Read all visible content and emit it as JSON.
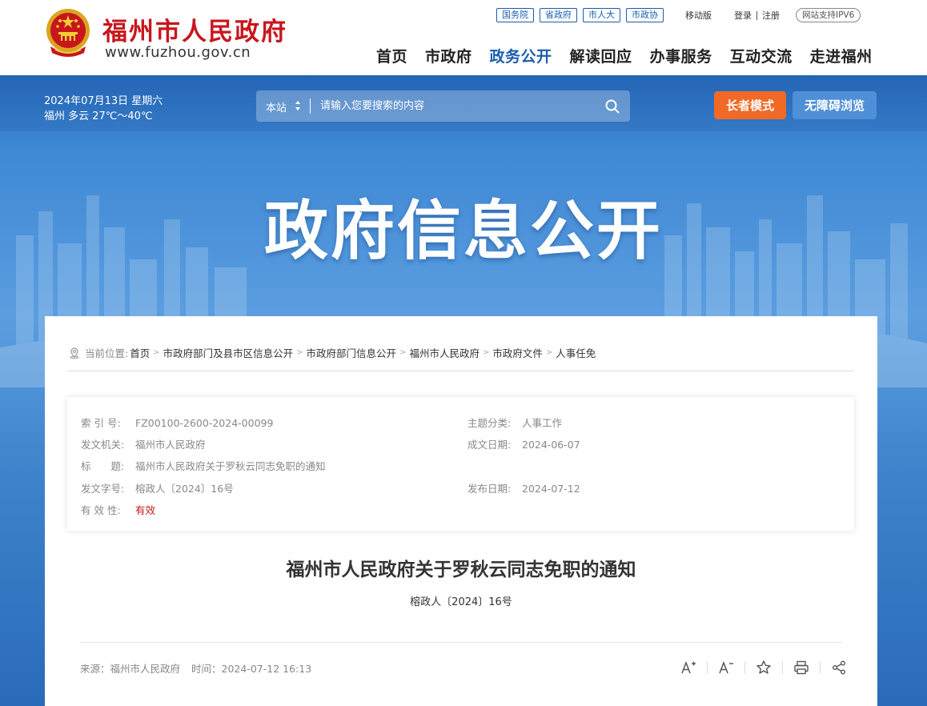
{
  "header": {
    "site_name": "福州市人民政府",
    "site_url": "www.fuzhou.gov.cn",
    "top_links": [
      "国务院",
      "省政府",
      "市人大",
      "市政协"
    ],
    "mobile": "移动版",
    "login": "登录",
    "register": "注册",
    "ipv6": "网站支持IPV6",
    "nav": [
      "首页",
      "市政府",
      "政务公开",
      "解读回应",
      "办事服务",
      "互动交流",
      "走进福州"
    ],
    "nav_active_index": 2
  },
  "banner": {
    "date": "2024年07月13日 星期六",
    "weather": "福州 多云 27℃～40℃",
    "search_scope": "本站",
    "search_placeholder": "请输入您要搜索的内容",
    "elder_mode": "长者模式",
    "accessible": "无障碍浏览",
    "hero_title": "政府信息公开"
  },
  "breadcrumb": {
    "label": "当前位置:",
    "items": [
      "首页",
      "市政府部门及县市区信息公开",
      "市政府部门信息公开",
      "福州市人民政府",
      "市政府文件",
      "人事任免"
    ],
    "separator": ">"
  },
  "meta": {
    "index_key": "索 引 号:",
    "index_val": "FZ00100-2600-2024-00099",
    "topic_key": "主题分类:",
    "topic_val": "人事工作",
    "issuer_key": "发文机关:",
    "issuer_val": "福州市人民政府",
    "created_key": "成文日期:",
    "created_val": "2024-06-07",
    "title_key": "标　　题:",
    "title_val": "福州市人民政府关于罗秋云同志免职的通知",
    "docno_key": "发文字号:",
    "docno_val": "榕政人〔2024〕16号",
    "published_key": "发布日期:",
    "published_val": "2024-07-12",
    "validity_key": "有 效 性:",
    "validity_val": "有效"
  },
  "document": {
    "title": "福州市人民政府关于罗秋云同志免职的通知",
    "number": "榕政人〔2024〕16号",
    "source": "来源：福州市人民政府",
    "time": "时间：2024-07-12 16:13"
  },
  "colors": {
    "brand_red": "#c8161d",
    "brand_blue": "#1a5dad",
    "elder_orange": "#f06a26",
    "access_blue": "#4f8fd8"
  }
}
